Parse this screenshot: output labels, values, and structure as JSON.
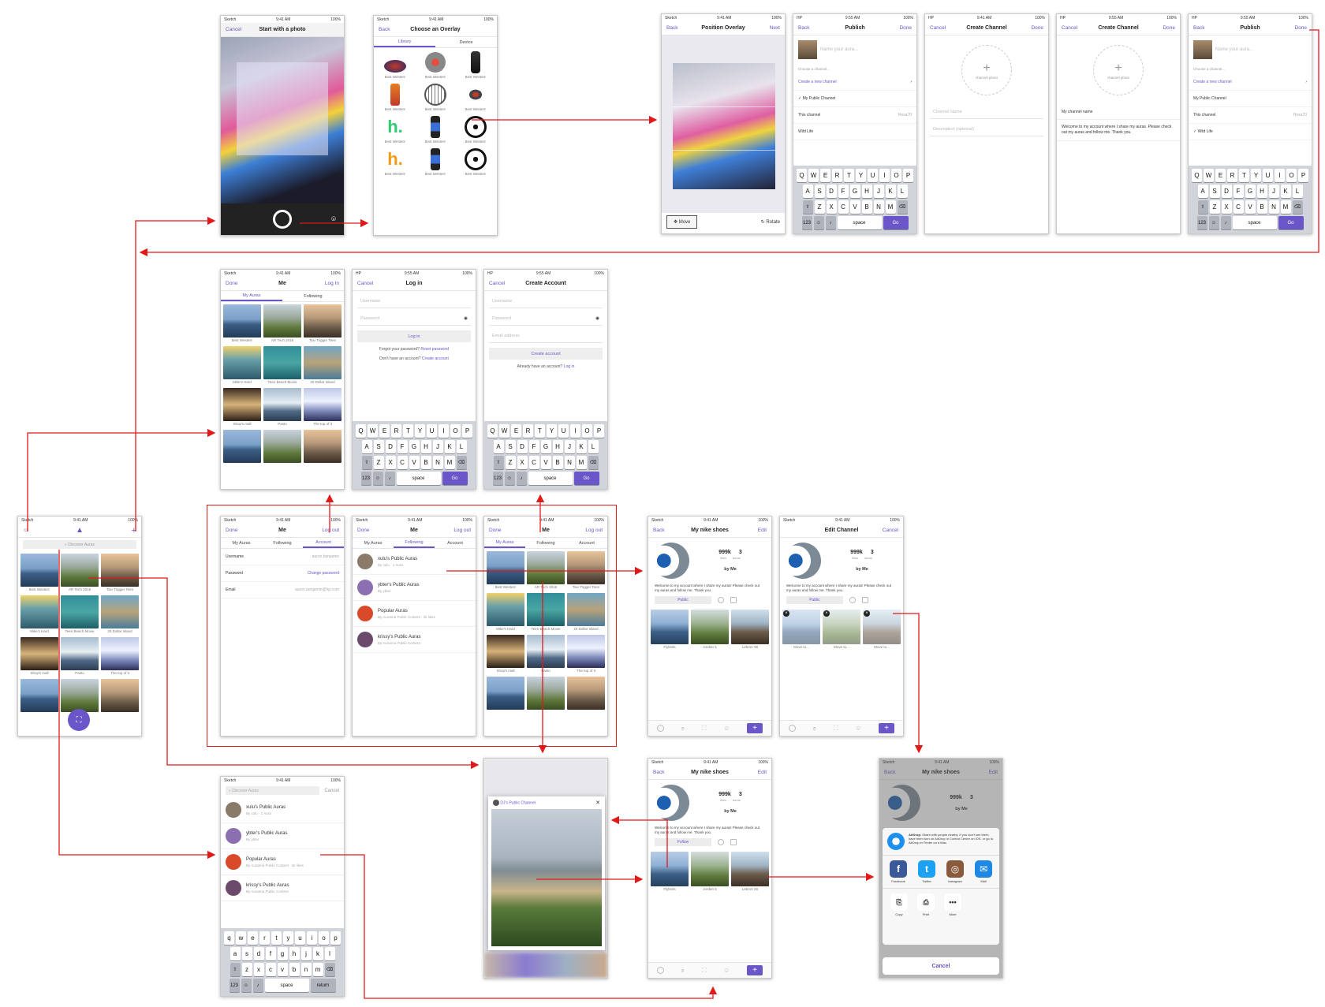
{
  "status": {
    "carrier": "Sketch",
    "carrier_hp": "HP",
    "time": "9:41 AM",
    "time2": "9:55 AM",
    "battery": "100%"
  },
  "captions": [
    "Best Western",
    "AR Tech 2016",
    "Taxi Trigger Teen",
    "Mike's Hard",
    "Teen Beach Movie",
    "20 Dollar Island",
    "Shop's mall",
    "Pasto",
    "The top of it"
  ],
  "s1": {
    "left": "Cancel",
    "title": "Start with a photo"
  },
  "s2": {
    "left": "Back",
    "title": "Choose an Overlay",
    "tab1": "Library",
    "tab2": "Device",
    "cap": "Best Western"
  },
  "s3": {
    "left": "Back",
    "title": "Position Overlay",
    "right": "Next",
    "move": "Move",
    "rotate": "Rotate"
  },
  "s4": {
    "left": "Back",
    "title": "Publish",
    "right": "Done",
    "placeholder": "Name your aura...",
    "choose": "Choose a channel...",
    "create": "Create a new channel",
    "ch1": "My Public Channel",
    "ch2": "This channel",
    "ch2v": "Hexa70",
    "ch3": "Wild Life"
  },
  "s5": {
    "left": "Cancel",
    "title": "Create Channel",
    "right": "Done",
    "photo": "channel photo",
    "name": "Channel Name",
    "desc": "Description (optional)"
  },
  "s6": {
    "name": "My channel name",
    "desc": "Welcome to my account where I share my auras. Please check out my auras and follow me. Thank you."
  },
  "kb": {
    "r1": [
      "Q",
      "W",
      "E",
      "R",
      "T",
      "Y",
      "U",
      "I",
      "O",
      "P"
    ],
    "r2": [
      "A",
      "S",
      "D",
      "F",
      "G",
      "H",
      "J",
      "K",
      "L"
    ],
    "r3": [
      "Z",
      "X",
      "C",
      "V",
      "B",
      "N",
      "M"
    ],
    "r1l": [
      "q",
      "w",
      "e",
      "r",
      "t",
      "y",
      "u",
      "i",
      "o",
      "p"
    ],
    "r2l": [
      "a",
      "s",
      "d",
      "f",
      "g",
      "h",
      "j",
      "k",
      "l"
    ],
    "r3l": [
      "z",
      "x",
      "c",
      "v",
      "b",
      "n",
      "m"
    ],
    "n123": "123",
    "space": "space",
    "go": "Go",
    "ret": "return"
  },
  "me": {
    "left": "Done",
    "title": "Me",
    "right": "Log In",
    "right2": "Log out",
    "tab1": "My Auras",
    "tab2": "Following",
    "tab3": "Account"
  },
  "login": {
    "left": "Cancel",
    "title": "Log in",
    "user": "Username",
    "pass": "Password",
    "btn": "Log in",
    "forgot": "Forgot your password?",
    "reset": "Reset password",
    "noacc": "Don't have an account?",
    "create": "Create account"
  },
  "create": {
    "left": "Cancel",
    "title": "Create Account",
    "user": "Username",
    "pass": "Password",
    "email": "Email address",
    "btn": "Create account",
    "already": "Already have an account?",
    "login": "Log in"
  },
  "home": {
    "search": "Discover Auras"
  },
  "account": {
    "k1": "Username",
    "v1": "aaron.benjamin",
    "k2": "Password",
    "v2": "Change password",
    "k3": "Email",
    "v3": "aaron.benjamin@hp.com"
  },
  "following": [
    {
      "name": "xulu's Public Auras",
      "sub": "By xulu · 1 Aura"
    },
    {
      "name": "ybter's Public Auras",
      "sub": "By ybter"
    },
    {
      "name": "Popular Auras",
      "sub": "By Auranna Public Content · 2k likes"
    },
    {
      "name": "krissy's Public Auras",
      "sub": "By Auranna Public Content"
    }
  ],
  "channel": {
    "left": "Back",
    "title": "My nike shoes",
    "right": "Edit",
    "views": "999k",
    "views_lbl": "likes",
    "auras": "3",
    "auras_lbl": "auras",
    "by": "by Me",
    "bio": "Welcome to my account where I share my auras! Please check out my auras and follow me. Thank you.",
    "public": "Public",
    "follow": "Follow",
    "tiles": [
      "Flyknits",
      "Jordan 5",
      "Lebron XII"
    ]
  },
  "edit": {
    "title": "Edit Channel",
    "right": "Cancel",
    "move": "Move to..."
  },
  "search": {
    "placeholder": "Discover Auras",
    "cancel": "Cancel"
  },
  "popup": {
    "channel": "DJ's Public Channel",
    "close": "✕"
  },
  "share": {
    "airdrop_title": "AirDrop.",
    "airdrop": "Share with people nearby. If you don't see them, have them turn on AirDrop in Control Center on iOS, or go to AirDrop in Finder on a Mac.",
    "apps": [
      "Facebook",
      "Twitter",
      "Instagram",
      "Mail"
    ],
    "acts": [
      "Copy",
      "Print",
      "More"
    ],
    "cancel": "Cancel"
  },
  "colors": {
    "accent": "#6a55c9",
    "arrow": "#e0191b"
  }
}
